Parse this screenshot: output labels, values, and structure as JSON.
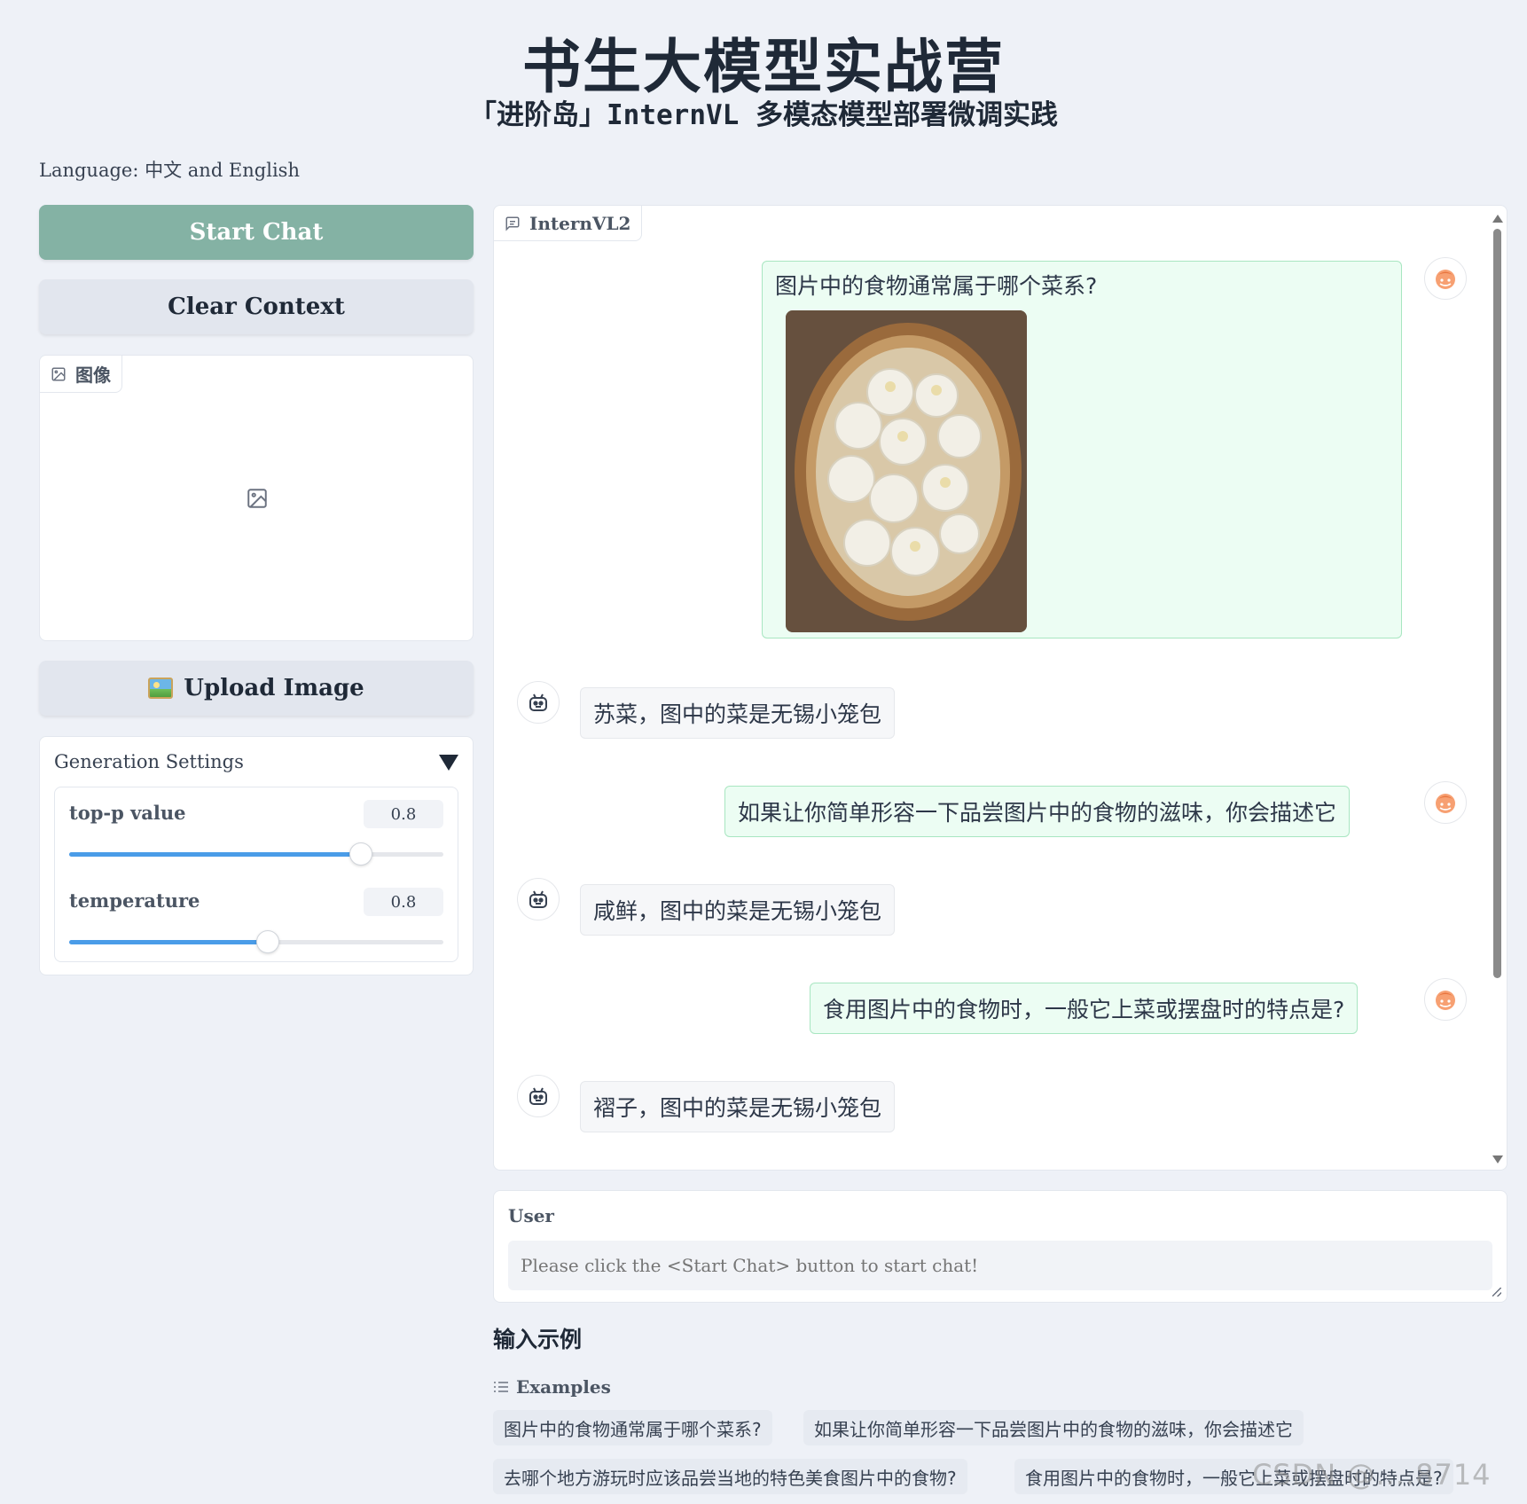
{
  "header": {
    "title": "书生大模型实战营",
    "subtitle": "「进阶岛」InternVL 多模态模型部署微调实践"
  },
  "language_note": "Language: 中文 and English",
  "sidebar": {
    "start_chat_label": "Start Chat",
    "clear_context_label": "Clear Context",
    "image_panel_label": "图像",
    "upload_image_label": "Upload Image",
    "generation_settings": {
      "title": "Generation Settings",
      "top_p": {
        "label": "top-p value",
        "value": "0.8",
        "fraction": 0.78
      },
      "temperature": {
        "label": "temperature",
        "value": "0.8",
        "fraction": 0.53
      }
    }
  },
  "chat": {
    "tab_label": "InternVL2",
    "messages": [
      {
        "role": "user",
        "text": "图片中的食物通常属于哪个菜系?",
        "has_image": true
      },
      {
        "role": "assistant",
        "text": "苏菜，图中的菜是无锡小笼包"
      },
      {
        "role": "user",
        "text": "如果让你简单形容一下品尝图片中的食物的滋味，你会描述它"
      },
      {
        "role": "assistant",
        "text": "咸鲜，图中的菜是无锡小笼包"
      },
      {
        "role": "user",
        "text": "食用图片中的食物时，一般它上菜或摆盘时的特点是?"
      },
      {
        "role": "assistant",
        "text": "褶子，图中的菜是无锡小笼包"
      }
    ]
  },
  "user_input": {
    "label": "User",
    "placeholder": "Please click the <Start Chat> button to start chat!"
  },
  "examples": {
    "heading": "输入示例",
    "label": "Examples",
    "items": [
      "图片中的食物通常属于哪个菜系?",
      "如果让你简单形容一下品尝图片中的食物的滋味，你会描述它",
      "去哪个地方游玩时应该品尝当地的特色美食图片中的食物?",
      "食用图片中的食物时，一般它上菜或摆盘时的特点是?"
    ]
  },
  "watermark": "CSDN @....8714",
  "colors": {
    "accent": "#84b2a4",
    "user_bubble": "#ecfdf3",
    "slider": "#4a9ce8",
    "background": "#eef1f7"
  }
}
